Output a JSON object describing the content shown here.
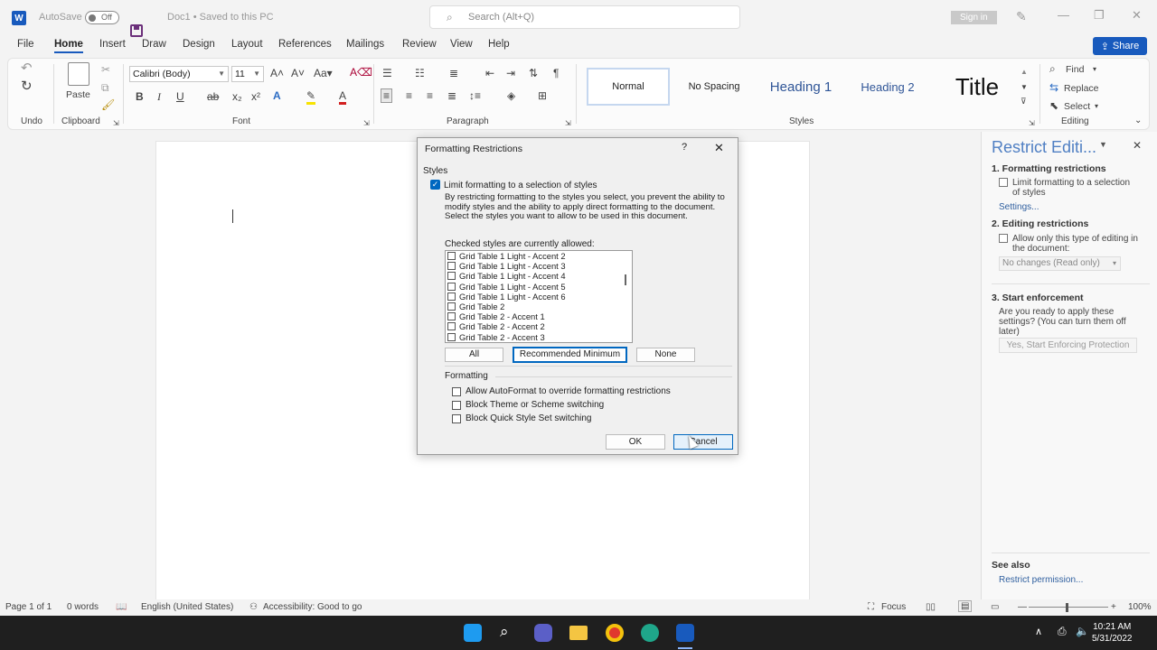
{
  "titlebar": {
    "app_icon_letter": "W",
    "autosave_label": "AutoSave",
    "autosave_state": "Off",
    "doc_title": "Doc1 • Saved to this PC",
    "search_placeholder": "Search (Alt+Q)",
    "signin_label": "Sign in"
  },
  "menu": {
    "tabs": [
      "File",
      "Home",
      "Insert",
      "Draw",
      "Design",
      "Layout",
      "References",
      "Mailings",
      "Review",
      "View",
      "Help"
    ],
    "share_label": "Share"
  },
  "ribbon": {
    "groups": {
      "undo": "Undo",
      "clipboard": "Clipboard",
      "font": "Font",
      "paragraph": "Paragraph",
      "styles": "Styles",
      "editing": "Editing"
    },
    "paste_label": "Paste",
    "font_name": "Calibri (Body)",
    "font_size": "11",
    "styles": [
      "Normal",
      "No Spacing",
      "Heading 1",
      "Heading 2",
      "Title"
    ],
    "find_label": "Find",
    "replace_label": "Replace",
    "select_label": "Select"
  },
  "side_pane": {
    "title": "Restrict Editi...",
    "section1_heading": "1. Formatting restrictions",
    "section1_checkbox": "Limit formatting to a selection of styles",
    "section1_link": "Settings...",
    "section2_heading": "2. Editing restrictions",
    "section2_checkbox": "Allow only this type of editing in the document:",
    "section2_combo": "No changes (Read only)",
    "section3_heading": "3. Start enforcement",
    "section3_text": "Are you ready to apply these settings? (You can turn them off later)",
    "section3_button": "Yes, Start Enforcing Protection",
    "see_also_heading": "See also",
    "see_also_link": "Restrict permission..."
  },
  "dialog": {
    "title": "Formatting Restrictions",
    "help": "?",
    "styles_heading": "Styles",
    "limit_label": "Limit formatting to a selection of styles",
    "limit_checked": true,
    "description": "By restricting formatting to the styles you select, you prevent the ability to modify styles and the ability to apply direct formatting to the document. Select the styles you want to allow to be used in this document.",
    "list_label": "Checked styles are currently allowed:",
    "style_list": [
      "Grid Table 1 Light - Accent 2",
      "Grid Table 1 Light - Accent 3",
      "Grid Table 1 Light - Accent 4",
      "Grid Table 1 Light - Accent 5",
      "Grid Table 1 Light - Accent 6",
      "Grid Table 2",
      "Grid Table 2 - Accent 1",
      "Grid Table 2 - Accent 2",
      "Grid Table 2 - Accent 3"
    ],
    "btn_all": "All",
    "btn_recommended": "Recommended Minimum",
    "btn_none": "None",
    "formatting_heading": "Formatting",
    "fmt_options": [
      "Allow AutoFormat to override formatting restrictions",
      "Block Theme or Scheme switching",
      "Block Quick Style Set switching"
    ],
    "btn_ok": "OK",
    "btn_cancel": "Cancel"
  },
  "statusbar": {
    "page": "Page 1 of 1",
    "words": "0 words",
    "language": "English (United States)",
    "accessibility": "Accessibility: Good to go",
    "focus": "Focus",
    "zoom": "100%"
  },
  "taskbar": {
    "time": "10:21 AM",
    "date": "5/31/2022"
  }
}
